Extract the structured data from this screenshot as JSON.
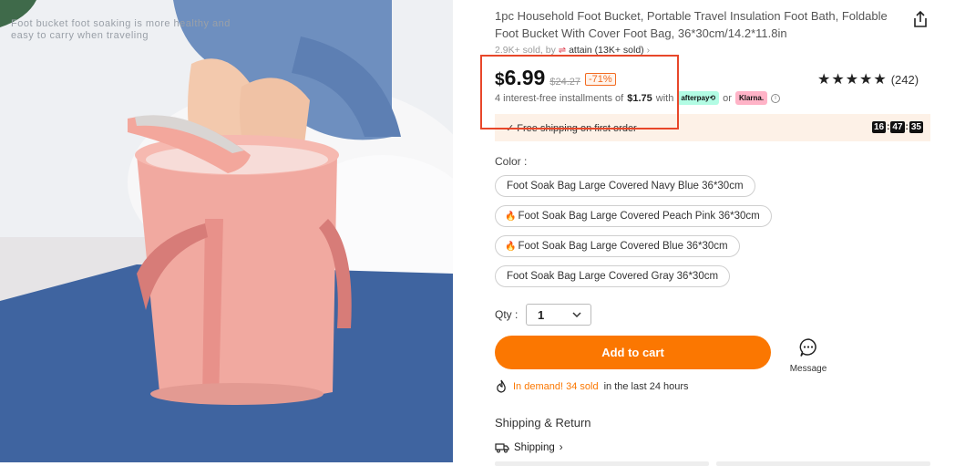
{
  "image": {
    "caption": "Foot bucket foot soaking is more healthy and easy to carry when traveling"
  },
  "product": {
    "title": "1pc Household Foot Bucket, Portable Travel Insulation Foot Bath, Foldable Foot Bucket With Cover Foot Bag, 36*30cm/14.2*11.8in",
    "sold": "2.9K+ sold, by",
    "store": "attain (13K+ sold)",
    "store_chevron": "›"
  },
  "price": {
    "currency": "$",
    "current": "6.99",
    "original": "$24.27",
    "discount": "-71%"
  },
  "rating": {
    "stars": "★★★★★",
    "value": 4.5,
    "count": "(242)"
  },
  "installments": {
    "text_before": "4 interest-free installments of",
    "amount": "$1.75",
    "text_with": "with",
    "afterpay": "afterpay⟲",
    "or": "or",
    "klarna": "Klarna."
  },
  "shipping_banner": {
    "text": "✓ Free shipping on first order",
    "timer_h": "16",
    "timer_m": "47",
    "timer_s": "35",
    "sep": ":"
  },
  "color": {
    "label": "Color :",
    "options": [
      {
        "label": "Foot Soak Bag Large Covered Navy Blue 36*30cm",
        "hot": false
      },
      {
        "label": "Foot Soak Bag Large Covered Peach Pink 36*30cm",
        "hot": true
      },
      {
        "label": "Foot Soak Bag Large Covered Blue 36*30cm",
        "hot": true
      },
      {
        "label": "Foot Soak Bag Large Covered Gray 36*30cm",
        "hot": false
      }
    ]
  },
  "quantity": {
    "label": "Qty :",
    "value": "1"
  },
  "actions": {
    "add_to_cart": "Add to cart",
    "message": "Message"
  },
  "demand": {
    "hot_text": "In demand! 34 sold",
    "rest": "in the last 24 hours"
  },
  "shipping_return": {
    "heading": "Shipping & Return",
    "shipping_link": "Shipping",
    "chevron": "›"
  },
  "colors": {
    "accent": "#fb7701",
    "highlight": "#e8472a",
    "bucket_pink": "#f1a9a0"
  }
}
